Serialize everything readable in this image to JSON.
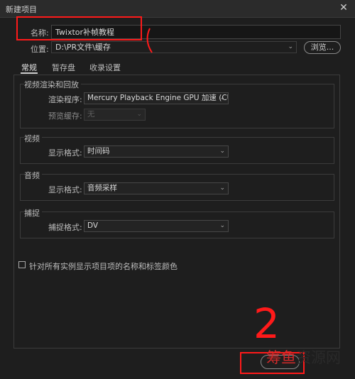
{
  "window": {
    "title": "新建项目",
    "close_icon": "close-icon"
  },
  "name": {
    "label": "名称:",
    "value": "Twixtor补帧教程"
  },
  "location": {
    "label": "位置:",
    "value": "D:\\PR文件\\缓存",
    "browse_label": "浏览..."
  },
  "tabs": [
    {
      "label": "常规",
      "active": true
    },
    {
      "label": "暂存盘"
    },
    {
      "label": "收录设置"
    }
  ],
  "video_render": {
    "title": "视频渲染和回放",
    "renderer_label": "渲染程序:",
    "renderer_value": "Mercury Playback Engine GPU 加速 (CUDA)",
    "preview_cache_label": "预览缓存:",
    "preview_cache_value": "无"
  },
  "video": {
    "title": "视频",
    "display_format_label": "显示格式:",
    "display_format_value": "时间码"
  },
  "audio": {
    "title": "音频",
    "display_format_label": "显示格式:",
    "display_format_value": "音频采样"
  },
  "capture": {
    "title": "捕捉",
    "capture_format_label": "捕捉格式:",
    "capture_format_value": "DV"
  },
  "checkbox_label": "针对所有实例显示项目项的名称和标签颜色",
  "annotations": {
    "number_two": "2",
    "annotation_color": "#ff1a1a"
  },
  "watermark": {
    "part1": "筹鱼",
    "part2": "资源网"
  }
}
